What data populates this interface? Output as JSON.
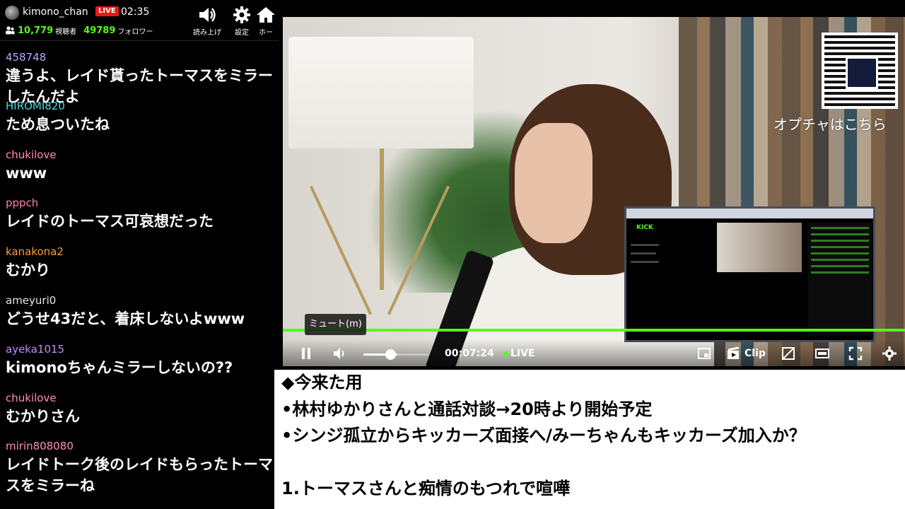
{
  "header": {
    "channel_name": "kimono_chan",
    "live_badge": "LIVE",
    "uptime": "02:35",
    "viewers": "10,779",
    "viewers_label": "視聴者",
    "followers": "49789",
    "followers_label": "フォロワー",
    "buttons": [
      {
        "label": "読み上げ",
        "icon": "speaker-icon"
      },
      {
        "label": "設定",
        "icon": "gear-icon"
      },
      {
        "label": "ホー",
        "icon": "home-icon"
      }
    ]
  },
  "chat": {
    "messages": [
      {
        "user": "458748",
        "color": "#b8a6ff",
        "text": "違うよ、レイド貰ったトーマスをミラーしたんだよ"
      },
      {
        "user": "HIROMI820",
        "color": "#4fd6e0",
        "text": "ため息ついたね"
      },
      {
        "user": "chukilove",
        "color": "#ff8fb6",
        "text": "www"
      },
      {
        "user": "pppch",
        "color": "#ff7fb0",
        "text": "レイドのトーマス可哀想だった"
      },
      {
        "user": "kanakona2",
        "color": "#ff9a3d",
        "text": "むかり"
      },
      {
        "user": "ameyuri0",
        "color": "#e8e8e8",
        "text": "どうせ43だと、着床しないよwww"
      },
      {
        "user": "ayeka1015",
        "color": "#c58cff",
        "text": "kimonoちゃんミラーしないの??"
      },
      {
        "user": "chukilove",
        "color": "#ff8fb6",
        "text": "むかりさん"
      },
      {
        "user": "mirin808080",
        "color": "#ff8fb6",
        "text": "レイドトーク後のレイドもらったトーマスをミラーね"
      }
    ]
  },
  "video": {
    "qr_caption": "オプチャはこちら",
    "tooltip": "ミュート(m)",
    "time": "00:07:24",
    "live_label": "LIVE",
    "clip_label": "Clip",
    "inner_logo": "KICK",
    "volume_level_fraction": 0.5,
    "accent_color": "#53fc18"
  },
  "agenda": {
    "lines": [
      "◆今来た用",
      "•林村ゆかりさんと通話対談→20時より開始予定",
      "•シンジ孤立からキッカーズ面接へ/みーちゃんもキッカーズ加入か？",
      "",
      "1.トーマスさんと痴情のもつれで喧嘩"
    ]
  }
}
